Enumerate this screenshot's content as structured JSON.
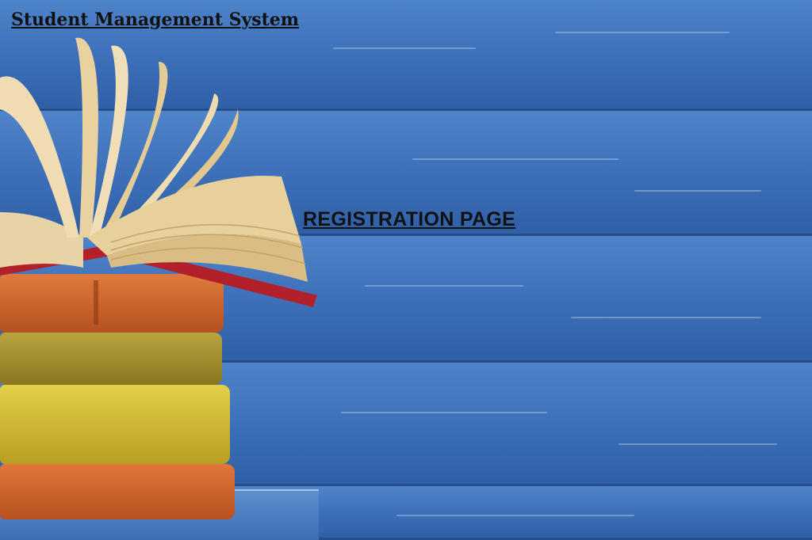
{
  "app": {
    "title": "Student Management System"
  },
  "page": {
    "heading": "REGISTRATION PAGE"
  },
  "background": {
    "description_colors": {
      "wood": "#3b6eb8",
      "book_orange": "#d0652c",
      "book_olive": "#a5922f",
      "book_yellow": "#d6c23a",
      "book_cover_red": "#b2202a",
      "pages": "#e7d3a6"
    }
  }
}
